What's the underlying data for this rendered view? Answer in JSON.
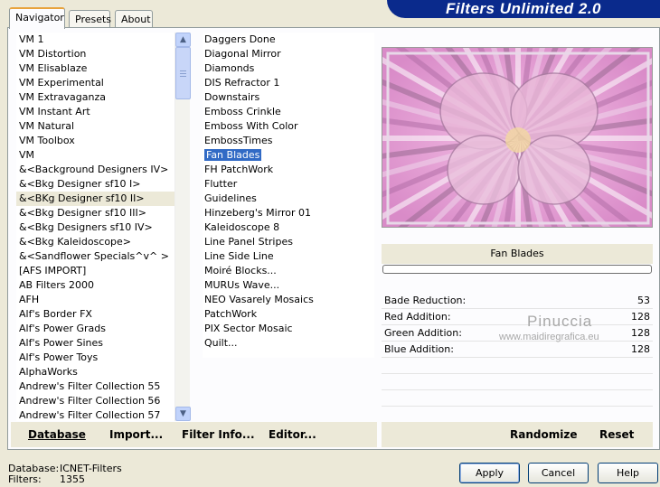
{
  "banner": "Filters Unlimited 2.0",
  "tabs": [
    "Navigator",
    "Presets",
    "About"
  ],
  "categories": [
    "VM 1",
    "VM Distortion",
    "VM Elisablaze",
    "VM Experimental",
    "VM Extravaganza",
    "VM Instant Art",
    "VM Natural",
    "VM Toolbox",
    "VM",
    "&<Background Designers IV>",
    "&<Bkg Designer sf10 I>",
    "&<BKg Designer sf10 II>",
    "&<Bkg Designer sf10 III>",
    "&<Bkg Designers sf10 IV>",
    "&<Bkg Kaleidoscope>",
    "&<Sandflower Specials^v^ >",
    "[AFS IMPORT]",
    "AB Filters 2000",
    "AFH",
    "Alf's Border FX",
    "Alf's Power Grads",
    "Alf's Power Sines",
    "Alf's Power Toys",
    "AlphaWorks",
    "Andrew's Filter Collection 55",
    "Andrew's Filter Collection 56",
    "Andrew's Filter Collection 57"
  ],
  "filters": [
    "Daggers Done",
    "Diagonal Mirror",
    "Diamonds",
    "DIS Refractor 1",
    "Downstairs",
    "Emboss Crinkle",
    "Emboss With Color",
    "EmbossTimes",
    "Fan Blades",
    "FH PatchWork",
    "Flutter",
    "Guidelines",
    "Hinzeberg's Mirror 01",
    "Kaleidoscope 8",
    "Line Panel Stripes",
    "Line Side Line",
    "Moiré Blocks...",
    "MURUs Wave...",
    "NEO Vasarely Mosaics",
    "PatchWork",
    "PIX Sector Mosaic",
    "Quilt..."
  ],
  "selected_filter": "Fan Blades",
  "filter_title": "Fan Blades",
  "params": [
    {
      "label": "Bade Reduction:",
      "value": "53"
    },
    {
      "label": "Red Addition:",
      "value": "128"
    },
    {
      "label": "Green Addition:",
      "value": "128"
    },
    {
      "label": "Blue Addition:",
      "value": "128"
    }
  ],
  "watermark": {
    "name": "Pinuccia",
    "url": "www.maidiregrafica.eu"
  },
  "toolbar": {
    "database": "Database",
    "import": "Import...",
    "filter_info": "Filter Info...",
    "editor": "Editor...",
    "randomize": "Randomize",
    "reset": "Reset"
  },
  "footer": {
    "database_label": "Database:",
    "database_value": "ICNET-Filters",
    "filters_label": "Filters:",
    "filters_value": "1355"
  },
  "buttons": {
    "apply": "Apply",
    "cancel": "Cancel",
    "help": "Help"
  }
}
